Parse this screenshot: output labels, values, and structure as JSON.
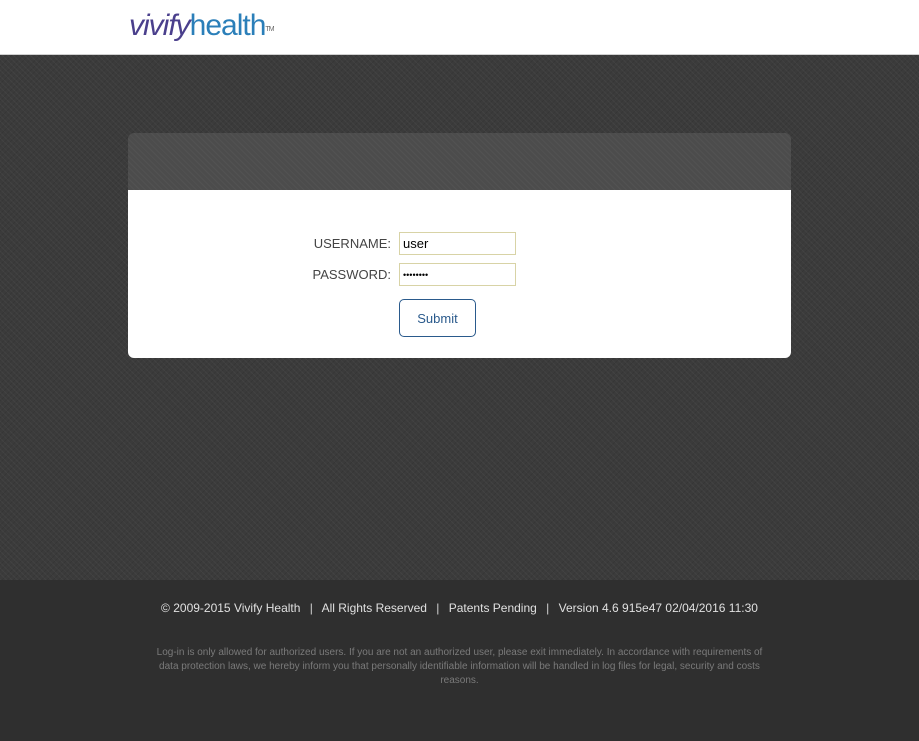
{
  "header": {
    "logo": {
      "part1": "vivify",
      "part2": "health",
      "trademark": "TM"
    }
  },
  "login": {
    "username_label": "USERNAME:",
    "username_value": "user",
    "password_label": "PASSWORD:",
    "password_value": "••••••••",
    "submit_label": "Submit"
  },
  "footer": {
    "copyright": "© 2009-2015 Vivify Health",
    "rights": "All Rights Reserved",
    "patents": "Patents Pending",
    "version": "Version 4.6 915e47 02/04/2016 11:30",
    "separator": "|",
    "disclaimer": "Log-in is only allowed for authorized users. If you are not an authorized user, please exit immediately. In accordance with requirements of data protection laws, we hereby inform you that personally identifiable information will be handled in log files for legal, security and costs reasons."
  },
  "colors": {
    "brand_purple": "#4a3f8c",
    "brand_blue": "#2b7fb9",
    "button_accent": "#2a5a8c",
    "background": "#3b3b3b"
  }
}
